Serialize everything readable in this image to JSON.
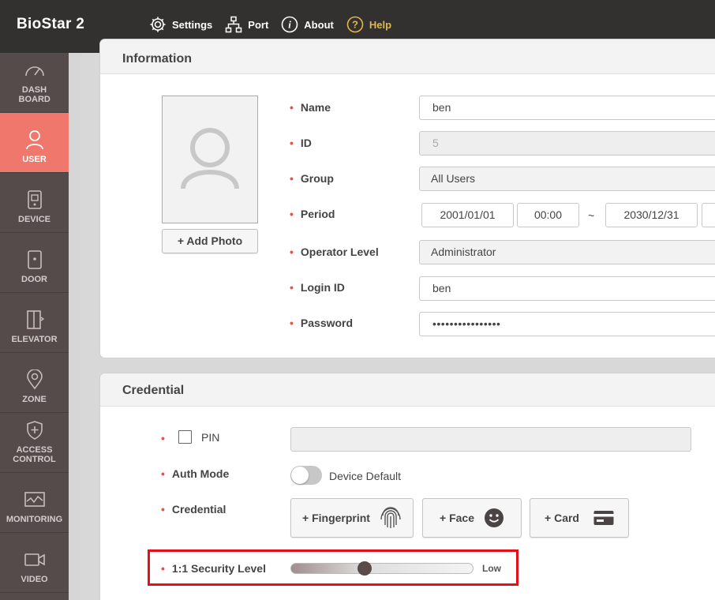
{
  "app": {
    "title": "BioStar 2"
  },
  "topnav": [
    {
      "label": "Settings",
      "icon": "gear-icon"
    },
    {
      "label": "Port",
      "icon": "network-icon"
    },
    {
      "label": "About",
      "icon": "info-icon"
    },
    {
      "label": "Help",
      "icon": "help-icon",
      "color": "#e0b84a"
    }
  ],
  "sidebar": {
    "items": [
      {
        "label": "DASH BOARD",
        "icon": "dashboard-icon"
      },
      {
        "label": "USER",
        "icon": "user-icon",
        "active": true
      },
      {
        "label": "DEVICE",
        "icon": "device-icon"
      },
      {
        "label": "DOOR",
        "icon": "door-icon"
      },
      {
        "label": "ELEVATOR",
        "icon": "elevator-icon"
      },
      {
        "label": "ZONE",
        "icon": "zone-icon"
      },
      {
        "label": "ACCESS CONTROL",
        "icon": "access-control-icon"
      },
      {
        "label": "MONITORING",
        "icon": "monitoring-icon"
      },
      {
        "label": "VIDEO",
        "icon": "video-icon"
      }
    ]
  },
  "information": {
    "heading": "Information",
    "add_photo_label": "+ Add Photo",
    "fields": {
      "name": {
        "label": "Name",
        "value": "ben"
      },
      "id": {
        "label": "ID",
        "value": "5"
      },
      "group": {
        "label": "Group",
        "value": "All Users"
      },
      "period": {
        "label": "Period",
        "start_date": "2001/01/01",
        "start_time": "00:00",
        "separator": "~",
        "end_date": "2030/12/31"
      },
      "operator_level": {
        "label": "Operator Level",
        "value": "Administrator"
      },
      "login_id": {
        "label": "Login ID",
        "value": "ben"
      },
      "password": {
        "label": "Password",
        "value": "••••••••••••••••"
      }
    }
  },
  "credential": {
    "heading": "Credential",
    "pin": {
      "label": "PIN",
      "checked": false,
      "value": ""
    },
    "auth_mode": {
      "label": "Auth Mode",
      "value": "Device Default",
      "enabled": false
    },
    "credential": {
      "label": "Credential",
      "buttons": [
        {
          "label": "+ Fingerprint",
          "icon": "fingerprint-icon"
        },
        {
          "label": "+ Face",
          "icon": "face-icon"
        },
        {
          "label": "+ Card",
          "icon": "card-icon"
        }
      ]
    },
    "security_level": {
      "label": "1:1 Security Level",
      "value": "Low"
    }
  },
  "colors": {
    "topbar": "#333030",
    "sidebar": "#554b4b",
    "sidebar_active": "#f0776b",
    "required_dot": "#e0554a",
    "highlight": "#e3101a"
  }
}
